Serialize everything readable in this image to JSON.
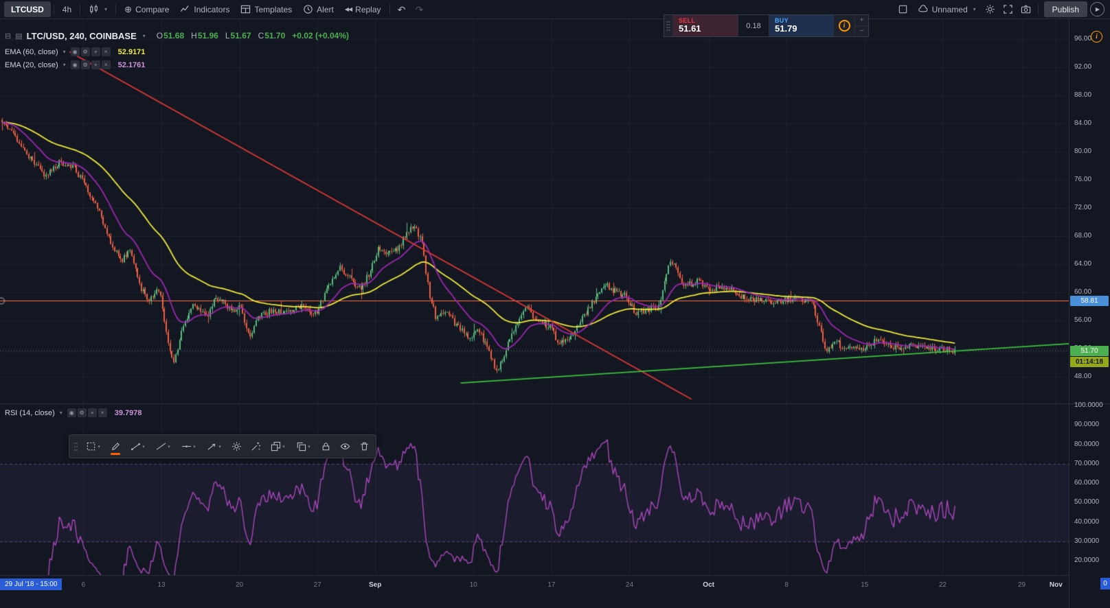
{
  "colors": {
    "bg": "#131722",
    "grid": "#1e222d",
    "up": "#58bd7d",
    "down": "#ef5f43",
    "ema60": "#f0e93a",
    "ema20": "#9c27b0",
    "rsi": "#ab47bc",
    "band": "#7e57c2",
    "trend_red": "#e53935",
    "trend_green": "#3cc23c",
    "hline": "#ff7043",
    "tag_level_bg": "#4a90d9",
    "tag_last_bg": "#4caf50",
    "tag_countdown_bg": "#94a81c",
    "sell_red": "#f23645",
    "buy_blue": "#4da6ff",
    "time_tag_blue": "#2a5cd8",
    "warning_orange": "#ff9800",
    "axis_text": "#b2b5be"
  },
  "icons": {
    "caret_down": "▾",
    "compare": "⊕",
    "replay": "◀◀",
    "undo": "↶",
    "redo": "↷",
    "play": "▶",
    "plus": "+",
    "minus": "−",
    "info": "i",
    "collapse": "⊟",
    "pane": "▤",
    "eye_mini": "◉",
    "gear_mini": "⚙",
    "add_mini": "+",
    "close_mini": "×"
  },
  "toolbar": {
    "symbol": "LTCUSD",
    "interval": "4h",
    "compare": "Compare",
    "indicators": "Indicators",
    "templates": "Templates",
    "alert": "Alert",
    "replay": "Replay",
    "layout_name": "Unnamed",
    "publish": "Publish"
  },
  "order_panel": {
    "sell_label": "SELL",
    "sell_price": "51.61",
    "spread": "0.18",
    "buy_label": "BUY",
    "buy_price": "51.79"
  },
  "legend": {
    "title": "LTC/USD, 240, COINBASE",
    "o_label": "O",
    "o_value": "51.68",
    "h_label": "H",
    "h_value": "51.96",
    "l_label": "L",
    "l_value": "51.67",
    "c_label": "C",
    "c_value": "51.70",
    "change": "+0.02 (+0.04%)",
    "ema60_label": "EMA (60, close)",
    "ema60_value": "52.9171",
    "ema20_label": "EMA (20, close)",
    "ema20_value": "52.1761"
  },
  "rsi_legend": {
    "label": "RSI (14, close)",
    "value": "39.7978"
  },
  "price_tags": {
    "level": "58.81",
    "last": "51.70",
    "countdown": "01:14:18"
  },
  "time_axis": {
    "left_tag": "29 Jul '18 - 15:00",
    "right_tag": "0",
    "ticks": [
      {
        "label": "6",
        "frac": 0.078,
        "month": false
      },
      {
        "label": "13",
        "frac": 0.151,
        "month": false
      },
      {
        "label": "20",
        "frac": 0.224,
        "month": false
      },
      {
        "label": "27",
        "frac": 0.297,
        "month": false
      },
      {
        "label": "Sep",
        "frac": 0.351,
        "month": true
      },
      {
        "label": "10",
        "frac": 0.443,
        "month": false
      },
      {
        "label": "17",
        "frac": 0.516,
        "month": false
      },
      {
        "label": "24",
        "frac": 0.589,
        "month": false
      },
      {
        "label": "Oct",
        "frac": 0.663,
        "month": true
      },
      {
        "label": "8",
        "frac": 0.736,
        "month": false
      },
      {
        "label": "15",
        "frac": 0.809,
        "month": false
      },
      {
        "label": "22",
        "frac": 0.882,
        "month": false
      },
      {
        "label": "29",
        "frac": 0.956,
        "month": false
      },
      {
        "label": "Nov",
        "frac": 0.988,
        "month": true
      }
    ]
  },
  "chart_data": {
    "type": "candlestick",
    "symbol": "LTC/USD",
    "interval": "240",
    "exchange": "COINBASE",
    "x_range": [
      "29 Jul '18 15:00",
      "Nov '18"
    ],
    "ohlc_last": {
      "open": 51.68,
      "high": 51.96,
      "low": 51.67,
      "close": 51.7,
      "change": 0.02,
      "change_pct": 0.04
    },
    "price_axis_ticks": [
      96,
      92,
      88,
      84,
      80,
      76,
      72,
      68,
      64,
      60,
      56,
      52,
      48
    ],
    "rsi_axis_ticks": [
      100,
      90,
      80,
      70,
      60,
      50,
      40,
      30,
      20
    ],
    "rsi_period": 14,
    "rsi_last": 39.7978,
    "ema60_last": 52.9171,
    "ema20_last": 52.1761,
    "candle_count": 500,
    "close_path": [
      [
        0.0,
        84.5
      ],
      [
        0.015,
        82.0
      ],
      [
        0.03,
        79.0
      ],
      [
        0.045,
        76.5
      ],
      [
        0.06,
        78.5
      ],
      [
        0.075,
        78.0
      ],
      [
        0.1,
        72.0
      ],
      [
        0.115,
        67.0
      ],
      [
        0.125,
        64.5
      ],
      [
        0.135,
        66.0
      ],
      [
        0.145,
        60.5
      ],
      [
        0.155,
        59.0
      ],
      [
        0.165,
        60.5
      ],
      [
        0.175,
        52.5
      ],
      [
        0.18,
        50.0
      ],
      [
        0.19,
        55.0
      ],
      [
        0.2,
        58.5
      ],
      [
        0.215,
        56.5
      ],
      [
        0.225,
        59.5
      ],
      [
        0.24,
        57.5
      ],
      [
        0.25,
        57.8
      ],
      [
        0.26,
        54.0
      ],
      [
        0.27,
        56.5
      ],
      [
        0.285,
        57.5
      ],
      [
        0.3,
        57.2
      ],
      [
        0.315,
        58.0
      ],
      [
        0.33,
        57.0
      ],
      [
        0.345,
        61.5
      ],
      [
        0.355,
        63.5
      ],
      [
        0.365,
        62.0
      ],
      [
        0.375,
        60.5
      ],
      [
        0.385,
        62.5
      ],
      [
        0.395,
        66.5
      ],
      [
        0.405,
        65.5
      ],
      [
        0.415,
        66.0
      ],
      [
        0.425,
        68.5
      ],
      [
        0.432,
        69.5
      ],
      [
        0.44,
        67.5
      ],
      [
        0.448,
        60.0
      ],
      [
        0.455,
        56.5
      ],
      [
        0.465,
        57.5
      ],
      [
        0.475,
        55.5
      ],
      [
        0.49,
        53.5
      ],
      [
        0.5,
        54.5
      ],
      [
        0.51,
        52.0
      ],
      [
        0.52,
        48.5
      ],
      [
        0.53,
        52.5
      ],
      [
        0.545,
        57.0
      ],
      [
        0.55,
        58.3
      ],
      [
        0.56,
        56.0
      ],
      [
        0.575,
        55.0
      ],
      [
        0.585,
        52.8
      ],
      [
        0.595,
        53.5
      ],
      [
        0.61,
        56.5
      ],
      [
        0.625,
        59.5
      ],
      [
        0.635,
        61.0
      ],
      [
        0.645,
        60.0
      ],
      [
        0.655,
        59.5
      ],
      [
        0.665,
        57.0
      ],
      [
        0.675,
        57.5
      ],
      [
        0.69,
        58.0
      ],
      [
        0.7,
        64.0
      ],
      [
        0.705,
        64.5
      ],
      [
        0.715,
        61.0
      ],
      [
        0.73,
        61.5
      ],
      [
        0.745,
        60.5
      ],
      [
        0.76,
        60.8
      ],
      [
        0.775,
        59.5
      ],
      [
        0.79,
        59.0
      ],
      [
        0.805,
        58.5
      ],
      [
        0.82,
        58.8
      ],
      [
        0.835,
        59.3
      ],
      [
        0.85,
        58.5
      ],
      [
        0.858,
        55.0
      ],
      [
        0.865,
        51.5
      ],
      [
        0.875,
        53.0
      ],
      [
        0.885,
        52.0
      ],
      [
        0.895,
        52.5
      ],
      [
        0.905,
        51.8
      ],
      [
        0.915,
        53.0
      ],
      [
        0.925,
        52.8
      ],
      [
        0.935,
        52.3
      ],
      [
        0.945,
        51.8
      ],
      [
        0.955,
        52.5
      ],
      [
        0.965,
        52.2
      ],
      [
        0.975,
        52.0
      ],
      [
        0.985,
        51.9
      ],
      [
        1.0,
        51.7
      ]
    ],
    "overlays": {
      "ema_periods": [
        60,
        20
      ],
      "red_trendline": {
        "x1": 0.065,
        "p1": 94.2,
        "x2": 0.647,
        "p2": 44.8
      },
      "green_trendline": {
        "x1": 0.431,
        "p1": 47.1,
        "x2": 1.0,
        "p2": 52.7
      },
      "horizontal_line": 58.81,
      "last_price": 51.7,
      "rsi_bands": [
        70,
        30
      ]
    }
  }
}
